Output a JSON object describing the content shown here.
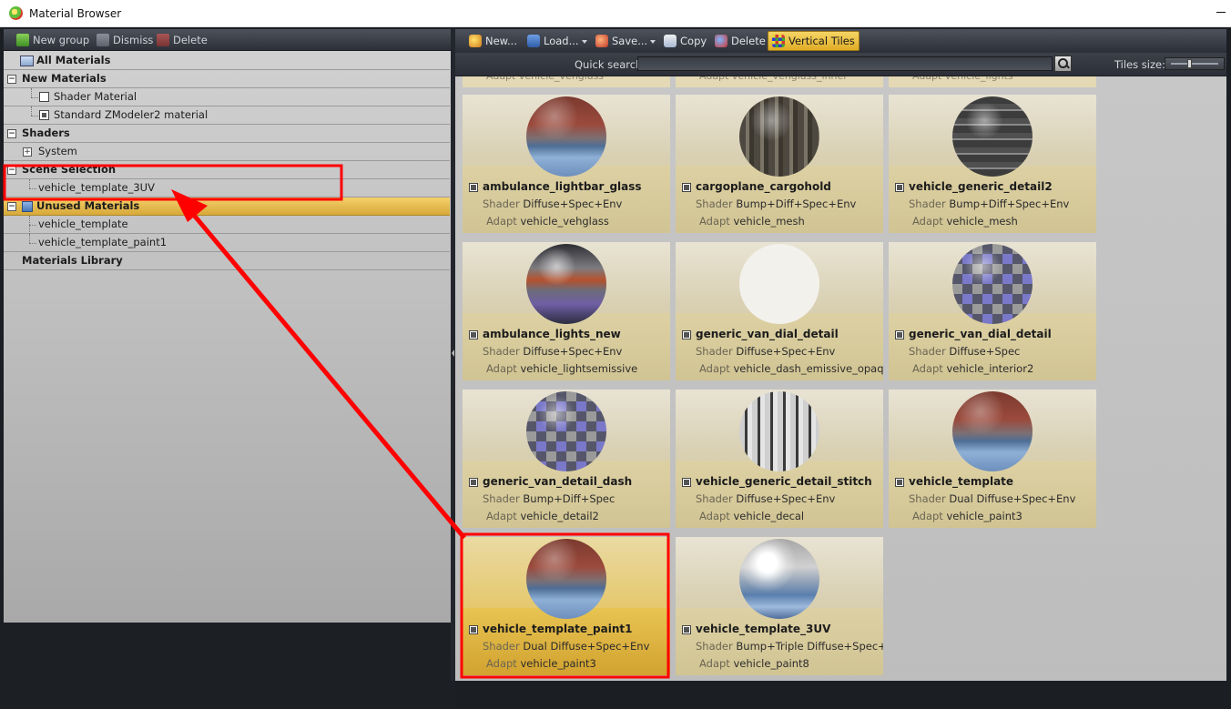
{
  "window": {
    "title": "Material Browser"
  },
  "left_toolbar": {
    "new_group": "New group",
    "dismiss": "Dismiss",
    "delete": "Delete"
  },
  "tree": {
    "all_materials": "All Materials",
    "new_materials": "New Materials",
    "shader_material": "Shader Material",
    "standard_material": "Standard ZModeler2 material",
    "shaders": "Shaders",
    "system": "System",
    "scene_selection": "Scene Selection",
    "scene_item": "vehicle_template_3UV",
    "unused_materials": "Unused Materials",
    "unused_item_1": "vehicle_template",
    "unused_item_2": "vehicle_template_paint1",
    "materials_library": "Materials Library"
  },
  "right_toolbar": {
    "new": "New...",
    "load": "Load...",
    "save": "Save...",
    "copy": "Copy",
    "delete": "Delete",
    "vertical_tiles": "Vertical Tiles",
    "quick_search_label": "Quick search:",
    "quick_search_value": "",
    "tiles_size_label": "Tiles size:"
  },
  "labels": {
    "shader": "Shader",
    "adapt": "Adapt"
  },
  "partial_row": [
    {
      "adapt": "vehicle_vehglass"
    },
    {
      "adapt": "vehicle_vehglass_inner"
    },
    {
      "adapt": "vehicle_lights"
    }
  ],
  "tiles": [
    {
      "name": "ambulance_lightbar_glass",
      "shader": "Diffuse+Spec+Env",
      "adapt": "vehicle_vehglass",
      "texture": "red-sky"
    },
    {
      "name": "cargoplane_cargohold",
      "shader": "Bump+Diff+Spec+Env",
      "adapt": "vehicle_mesh",
      "texture": "metal"
    },
    {
      "name": "vehicle_generic_detail2",
      "shader": "Bump+Diff+Spec+Env",
      "adapt": "vehicle_mesh",
      "texture": "dark-metal"
    },
    {
      "name": "ambulance_lights_new",
      "shader": "Diffuse+Spec+Env",
      "adapt": "vehicle_lightsemissive",
      "texture": "lights"
    },
    {
      "name": "generic_van_dial_detail",
      "shader": "Diffuse+Spec+Env",
      "adapt": "vehicle_dash_emissive_opaque",
      "texture": "white"
    },
    {
      "name": "generic_van_dial_detail",
      "shader": "Diffuse+Spec",
      "adapt": "vehicle_interior2",
      "texture": "checker-blue"
    },
    {
      "name": "generic_van_detail_dash",
      "shader": "Bump+Diff+Spec",
      "adapt": "vehicle_detail2",
      "texture": "checker-blue"
    },
    {
      "name": "vehicle_generic_detail_stitch",
      "shader": "Diffuse+Spec+Env",
      "adapt": "vehicle_decal",
      "texture": "stitch"
    },
    {
      "name": "vehicle_template",
      "shader": "Dual Diffuse+Spec+Env",
      "adapt": "vehicle_paint3",
      "texture": "red-sky"
    },
    {
      "name": "vehicle_template_paint1",
      "shader": "Dual Diffuse+Spec+Env",
      "adapt": "vehicle_paint3",
      "texture": "red-sky",
      "selected": true
    },
    {
      "name": "vehicle_template_3UV",
      "shader": "Bump+Triple Diffuse+Spec+...",
      "adapt": "vehicle_paint8",
      "texture": "cloud"
    }
  ],
  "colors": {
    "selection_gold": "#e0ac25",
    "annotation_red": "#ff0000",
    "toolbar_dark": "#2d3038"
  }
}
